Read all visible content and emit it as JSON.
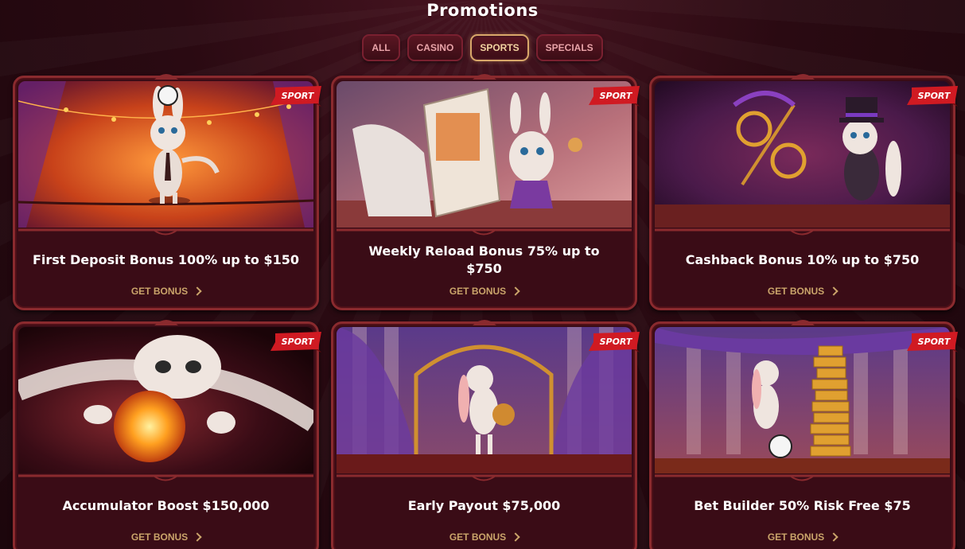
{
  "page": {
    "title": "Promotions"
  },
  "filters": [
    {
      "label": "ALL",
      "active": false
    },
    {
      "label": "CASINO",
      "active": false
    },
    {
      "label": "SPORTS",
      "active": true
    },
    {
      "label": "SPECIALS",
      "active": false
    }
  ],
  "cards": [
    {
      "badge": "SPORT",
      "title": "First Deposit Bonus 100% up to $150",
      "cta": "GET BONUS"
    },
    {
      "badge": "SPORT",
      "title": "Weekly Reload Bonus 75% up to $750",
      "cta": "GET BONUS"
    },
    {
      "badge": "SPORT",
      "title": "Cashback Bonus 10% up to $750",
      "cta": "GET BONUS"
    },
    {
      "badge": "SPORT",
      "title": "Accumulator Boost $150,000",
      "cta": "GET BONUS"
    },
    {
      "badge": "SPORT",
      "title": "Early Payout $75,000",
      "cta": "GET BONUS"
    },
    {
      "badge": "SPORT",
      "title": "Bet Builder 50% Risk Free $75",
      "cta": "GET BONUS"
    }
  ],
  "colors": {
    "background": "#2a0a12",
    "card_border": "#8a2a2e",
    "badge_red": "#d01a22",
    "cta_gold": "#caa46a",
    "active_tab_border": "#d9a86a"
  }
}
